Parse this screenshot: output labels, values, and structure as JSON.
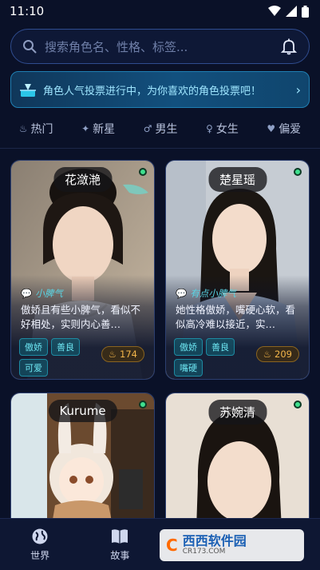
{
  "status": {
    "time": "11:10"
  },
  "search": {
    "placeholder": "搜索角色名、性格、标签..."
  },
  "banner": {
    "text": "角色人气投票进行中，为你喜欢的角色投票吧！"
  },
  "categories": [
    {
      "label": "热门",
      "icon": "flame-icon"
    },
    {
      "label": "新星",
      "icon": "sparkle-icon"
    },
    {
      "label": "男生",
      "icon": "male-icon"
    },
    {
      "label": "女生",
      "icon": "female-icon"
    },
    {
      "label": "偏爱",
      "icon": "heart-icon"
    }
  ],
  "cards": [
    {
      "name": "花潋滟",
      "mood": "小脾气",
      "desc": "傲娇且有些小脾气，看似不好相处，实则内心善…",
      "tags": [
        "傲娇",
        "善良",
        "可爱"
      ],
      "likes": "174"
    },
    {
      "name": "楚星瑶",
      "mood": "有点小脾气",
      "desc": "她性格傲娇，嘴硬心软，看似高冷难以接近，实…",
      "tags": [
        "傲娇",
        "善良",
        "嘴硬"
      ],
      "likes": "209"
    },
    {
      "name": "Kurume"
    },
    {
      "name": "苏婉清"
    }
  ],
  "nav": [
    {
      "label": "世界",
      "icon": "globe-icon"
    },
    {
      "label": "故事",
      "icon": "book-icon"
    }
  ],
  "watermark": {
    "brand": "西西软件园",
    "url": "CR173.COM"
  }
}
